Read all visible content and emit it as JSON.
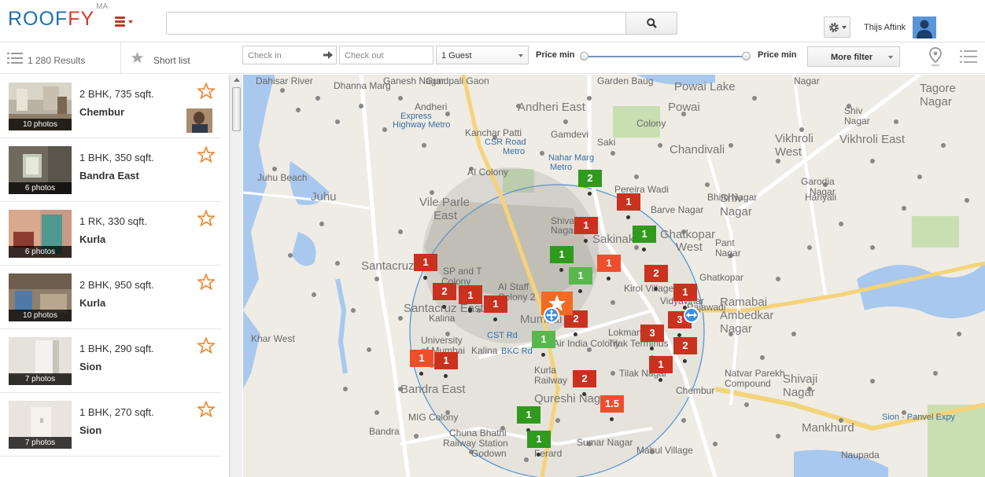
{
  "app": {
    "logo_main": "ROOF",
    "logo_accent": "FY",
    "logo_sup": "MA",
    "username": "Thijs Aftink"
  },
  "search": {
    "value": "",
    "placeholder": ""
  },
  "subbar": {
    "results_label": "1 280 Results",
    "shortlist_label": "Short list",
    "checkin_placeholder": "Check in",
    "checkout_placeholder": "Check out",
    "guests_value": "1 Guest",
    "price_min_label": "Price min",
    "price_max_label": "Price min",
    "more_filter_label": "More filter"
  },
  "listings": [
    {
      "title": "2 BHK, 735 sqft.",
      "area": "Chembur",
      "photos": "10 photos",
      "has_host": true
    },
    {
      "title": "1 BHK, 350 sqft.",
      "area": "Bandra East",
      "photos": "6 photos",
      "has_host": false
    },
    {
      "title": "1 RK, 330 sqft.",
      "area": "Kurla",
      "photos": "6 photos",
      "has_host": false
    },
    {
      "title": "2 BHK, 950 sqft.",
      "area": "Kurla",
      "photos": "10 photos",
      "has_host": false
    },
    {
      "title": "1 BHK, 290 sqft.",
      "area": "Sion",
      "photos": "7 photos",
      "has_host": false
    },
    {
      "title": "1 BHK, 270 sqft.",
      "area": "Sion",
      "photos": "7 photos",
      "has_host": false
    }
  ],
  "map": {
    "labels": [
      "Dahisar River",
      "Ganesh Nagar",
      "Gundpali Gaon",
      "Powai Lake",
      "Garden Baug",
      "Nagar",
      "Tagore",
      "Nagar",
      "Dhanna Marg",
      "Andheri East",
      "Powai",
      "Shiv",
      "Nagar",
      "Vikhroli",
      "West",
      "Vikhroli East",
      "Andheri",
      "Express",
      "Highway Metro",
      "Gamdevi",
      "Chandivali",
      "Saki",
      "Kanchar Patti",
      "CSR Road",
      "Metro",
      "Nahar Marg",
      "Metro",
      "Colony",
      "Juhu Beach",
      "Vile Parle",
      "East",
      "Pereira Wadi",
      "Garodia",
      "Nagar",
      "Juhu",
      "AI Colony",
      "Shivaji",
      "Nagar",
      "Sakinaka",
      "Ghatkopar",
      "West",
      "Barve Nagar",
      "Bhim Nagar",
      "Shiv",
      "Nagar",
      "Hariyali",
      "Pant",
      "Nagar",
      "Santacruz",
      "SP and T",
      "Colony",
      "AI Staff",
      "Colony 2",
      "Kirol Village",
      "Ghatkopar",
      "Vidyavihar",
      "Santacruz East",
      "Kalina",
      "CST Rd",
      "Mumbai",
      "Rajawadi",
      "Ramabai",
      "Ambedkar",
      "Nagar",
      "Khar West",
      "University",
      "of Mumbai",
      "Kalina",
      "Air India Colony",
      "Lokmanya",
      "Tilak Terminus",
      "Tilak Nagar",
      "Natvar Parekh",
      "Compound",
      "Shivaji",
      "Nagar",
      "Bandra East",
      "Kurla",
      "Railway",
      "BKC Rd",
      "Qureshi Nagar",
      "Chembur",
      "Mankhurd",
      "Sion - Panvel Expy",
      "Bandra",
      "MIG Colony",
      "Chuna Bhathi",
      "Railway Station",
      "Godown",
      "Ferard",
      "Sumar Nagar",
      "Mahul Village",
      "Naupada"
    ],
    "markers": [
      {
        "value": "2",
        "color": "green"
      },
      {
        "value": "1",
        "color": "red"
      },
      {
        "value": "1",
        "color": "red"
      },
      {
        "value": "1",
        "color": "green"
      },
      {
        "value": "1",
        "color": "green"
      },
      {
        "value": "1",
        "color": "orange"
      },
      {
        "value": "1",
        "color": "lgreen"
      },
      {
        "value": "1",
        "color": "red"
      },
      {
        "value": "2",
        "color": "red"
      },
      {
        "value": "1",
        "color": "red"
      },
      {
        "value": "1",
        "color": "red"
      },
      {
        "value": "2",
        "color": "red"
      },
      {
        "value": "1",
        "color": "red"
      },
      {
        "value": "1",
        "color": "red"
      },
      {
        "value": "2",
        "color": "red"
      },
      {
        "value": "3",
        "color": "red"
      },
      {
        "value": "3",
        "color": "red"
      },
      {
        "value": "2",
        "color": "red"
      },
      {
        "value": "1",
        "color": "lgreen"
      },
      {
        "value": "1",
        "color": "orange"
      },
      {
        "value": "1",
        "color": "red"
      },
      {
        "value": "1",
        "color": "red"
      },
      {
        "value": "2",
        "color": "red"
      },
      {
        "value": "1.5",
        "color": "orange"
      },
      {
        "value": "1",
        "color": "green"
      },
      {
        "value": "1",
        "color": "green"
      }
    ],
    "colors": {
      "red": "#c9321f",
      "orange": "#ef4e2c",
      "green": "#2f9a1e",
      "lgreen": "#57b84d",
      "accent": "#f36b21"
    }
  }
}
